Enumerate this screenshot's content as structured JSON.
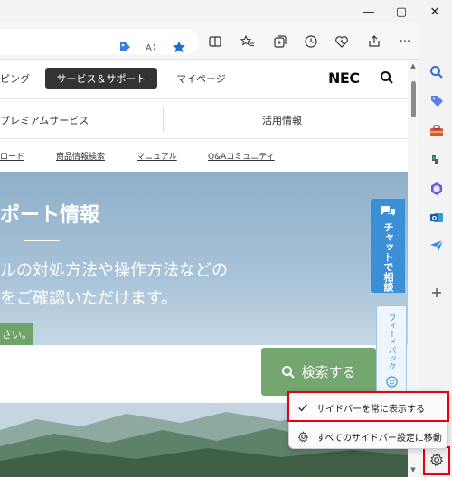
{
  "window": {
    "minimize": "—",
    "maximize": "▢",
    "close": "✕"
  },
  "toolbar": {
    "icons": [
      "app-guard-icon",
      "read-aloud-icon",
      "favorite-star-icon",
      "split-screen-icon",
      "favorites-icon",
      "collections-icon",
      "history-icon",
      "browser-essentials-icon",
      "share-icon",
      "more-icon",
      "copilot-icon"
    ],
    "more_label": "···"
  },
  "site": {
    "nav1": {
      "item_left": "ピング",
      "active": "サービス＆サポート",
      "mypage": "マイページ",
      "logo": "NEC"
    },
    "nav2": {
      "left": "プレミアムサービス",
      "right": "活用情報"
    },
    "nav3": {
      "items": [
        "ロード",
        "商品情報検索",
        "マニュアル",
        "Q&Aコミュニティ"
      ]
    },
    "hero": {
      "title": "ポート情報",
      "line1": "ルの対処方法や操作方法などの",
      "line2": "をご確認いただけます。",
      "green_label": "さい。",
      "search_button": "検索する",
      "chat_label": "チャットで相談",
      "feedback_label": "フィードバック"
    }
  },
  "sidebar": {
    "icons": [
      "search-icon",
      "shopping-tag-icon",
      "tools-icon",
      "games-icon",
      "microsoft365-icon",
      "outlook-icon",
      "drop-icon",
      "add-icon",
      "settings-icon"
    ]
  },
  "context_menu": {
    "items": [
      {
        "label": "サイドバーを常に表示する",
        "icon": "checkmark-icon"
      },
      {
        "label": "すべてのサイドバー設定に移動",
        "icon": "gear-icon"
      }
    ]
  },
  "colors": {
    "highlight": "#e60012",
    "accent": "#0067c0",
    "search_green": "#74a670",
    "chat_blue": "#3a8fd6"
  }
}
